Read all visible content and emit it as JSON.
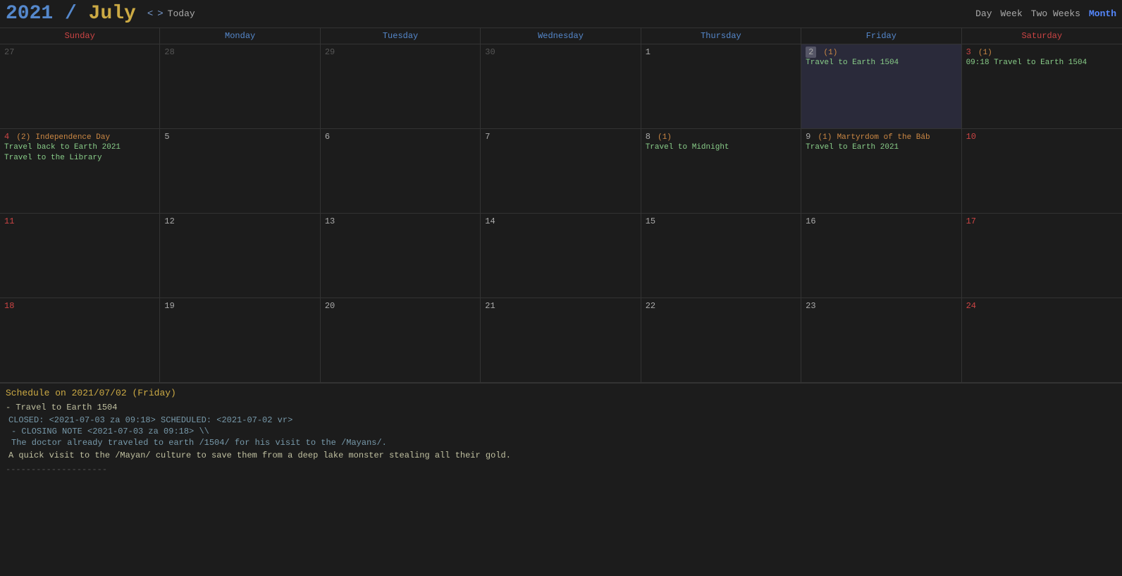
{
  "header": {
    "year": "2021",
    "slash": "/",
    "month_name": "July",
    "nav_prev": "<",
    "nav_next": ">",
    "today_label": "Today",
    "views": [
      "Day",
      "Week",
      "Two Weeks",
      "Month"
    ],
    "active_view": "Month"
  },
  "day_headers": [
    {
      "label": "Sunday",
      "type": "sunday"
    },
    {
      "label": "Monday",
      "type": "weekday"
    },
    {
      "label": "Tuesday",
      "type": "weekday"
    },
    {
      "label": "Wednesday",
      "type": "weekday"
    },
    {
      "label": "Thursday",
      "type": "weekday"
    },
    {
      "label": "Friday",
      "type": "weekday"
    },
    {
      "label": "Saturday",
      "type": "saturday"
    }
  ],
  "weeks": [
    {
      "days": [
        {
          "num": "27",
          "badi": "",
          "holiday": "",
          "events": [],
          "other_month": true,
          "is_sunday": false,
          "is_saturday": false
        },
        {
          "num": "28",
          "badi": "",
          "holiday": "",
          "events": [],
          "other_month": true,
          "is_sunday": false,
          "is_saturday": false
        },
        {
          "num": "29",
          "badi": "",
          "holiday": "",
          "events": [],
          "other_month": true,
          "is_sunday": false,
          "is_saturday": false
        },
        {
          "num": "30",
          "badi": "",
          "holiday": "",
          "events": [],
          "other_month": true,
          "is_sunday": false,
          "is_saturday": false
        },
        {
          "num": "1",
          "badi": "",
          "holiday": "",
          "events": [],
          "other_month": false,
          "is_sunday": false,
          "is_saturday": false
        },
        {
          "num": "2",
          "badi": "(1)",
          "holiday": "",
          "events": [
            {
              "text": "Travel to Earth 1504",
              "type": "normal"
            }
          ],
          "other_month": false,
          "is_sunday": false,
          "is_saturday": false,
          "is_today": true
        },
        {
          "num": "3",
          "badi": "(1)",
          "holiday": "",
          "events": [
            {
              "text": "09:18 Travel to Earth 1504",
              "type": "normal"
            }
          ],
          "other_month": false,
          "is_sunday": false,
          "is_saturday": true
        }
      ]
    },
    {
      "days": [
        {
          "num": "4",
          "badi": "(2)",
          "holiday": "Independence Day",
          "events": [
            {
              "text": "Travel back to Earth 2021",
              "type": "normal"
            },
            {
              "text": "Travel to the Library",
              "type": "normal"
            }
          ],
          "other_month": false,
          "is_sunday": true,
          "is_saturday": false
        },
        {
          "num": "5",
          "badi": "",
          "holiday": "",
          "events": [],
          "other_month": false,
          "is_sunday": false,
          "is_saturday": false
        },
        {
          "num": "6",
          "badi": "",
          "holiday": "",
          "events": [],
          "other_month": false,
          "is_sunday": false,
          "is_saturday": false
        },
        {
          "num": "7",
          "badi": "",
          "holiday": "",
          "events": [],
          "other_month": false,
          "is_sunday": false,
          "is_saturday": false
        },
        {
          "num": "8",
          "badi": "(1)",
          "holiday": "",
          "events": [
            {
              "text": "Travel to Midnight",
              "type": "normal"
            }
          ],
          "other_month": false,
          "is_sunday": false,
          "is_saturday": false
        },
        {
          "num": "9",
          "badi": "(1)",
          "holiday": "Martyrdom of the Báb",
          "events": [
            {
              "text": "Travel to Earth 2021",
              "type": "normal"
            }
          ],
          "other_month": false,
          "is_sunday": false,
          "is_saturday": false
        },
        {
          "num": "10",
          "badi": "",
          "holiday": "",
          "events": [],
          "other_month": false,
          "is_sunday": false,
          "is_saturday": true
        }
      ]
    },
    {
      "days": [
        {
          "num": "11",
          "badi": "",
          "holiday": "",
          "events": [],
          "other_month": false,
          "is_sunday": true,
          "is_saturday": false
        },
        {
          "num": "12",
          "badi": "",
          "holiday": "",
          "events": [],
          "other_month": false,
          "is_sunday": false,
          "is_saturday": false
        },
        {
          "num": "13",
          "badi": "",
          "holiday": "",
          "events": [],
          "other_month": false,
          "is_sunday": false,
          "is_saturday": false
        },
        {
          "num": "14",
          "badi": "",
          "holiday": "",
          "events": [],
          "other_month": false,
          "is_sunday": false,
          "is_saturday": false
        },
        {
          "num": "15",
          "badi": "",
          "holiday": "",
          "events": [],
          "other_month": false,
          "is_sunday": false,
          "is_saturday": false
        },
        {
          "num": "16",
          "badi": "",
          "holiday": "",
          "events": [],
          "other_month": false,
          "is_sunday": false,
          "is_saturday": false
        },
        {
          "num": "17",
          "badi": "",
          "holiday": "",
          "events": [],
          "other_month": false,
          "is_sunday": false,
          "is_saturday": true
        }
      ]
    },
    {
      "days": [
        {
          "num": "18",
          "badi": "",
          "holiday": "",
          "events": [],
          "other_month": false,
          "is_sunday": true,
          "is_saturday": false
        },
        {
          "num": "19",
          "badi": "",
          "holiday": "",
          "events": [],
          "other_month": false,
          "is_sunday": false,
          "is_saturday": false
        },
        {
          "num": "20",
          "badi": "",
          "holiday": "",
          "events": [],
          "other_month": false,
          "is_sunday": false,
          "is_saturday": false
        },
        {
          "num": "21",
          "badi": "",
          "holiday": "",
          "events": [],
          "other_month": false,
          "is_sunday": false,
          "is_saturday": false
        },
        {
          "num": "22",
          "badi": "",
          "holiday": "",
          "events": [],
          "other_month": false,
          "is_sunday": false,
          "is_saturday": false
        },
        {
          "num": "23",
          "badi": "",
          "holiday": "",
          "events": [],
          "other_month": false,
          "is_sunday": false,
          "is_saturday": false
        },
        {
          "num": "24",
          "badi": "",
          "holiday": "",
          "events": [],
          "other_month": false,
          "is_sunday": false,
          "is_saturday": true
        }
      ]
    }
  ],
  "schedule": {
    "title": "Schedule on 2021/07/02 (Friday)",
    "items": [
      {
        "dash": "-",
        "title": "Travel to Earth 1504",
        "closed": "CLOSED: <2021-07-03 za 09:18> SCHEDULED: <2021-07-02 vr>",
        "closing_note_label": "- CLOSING NOTE <2021-07-03 za 09:18> \\\\",
        "closing_note_line1": "The doctor already traveled to earth /1504/ for his visit to the /Mayans/.",
        "closing_note_line2": "",
        "description": "A quick visit to the /Mayan/ culture to save them from a deep lake monster stealing all their gold.",
        "divider": "--------------------"
      }
    ]
  }
}
